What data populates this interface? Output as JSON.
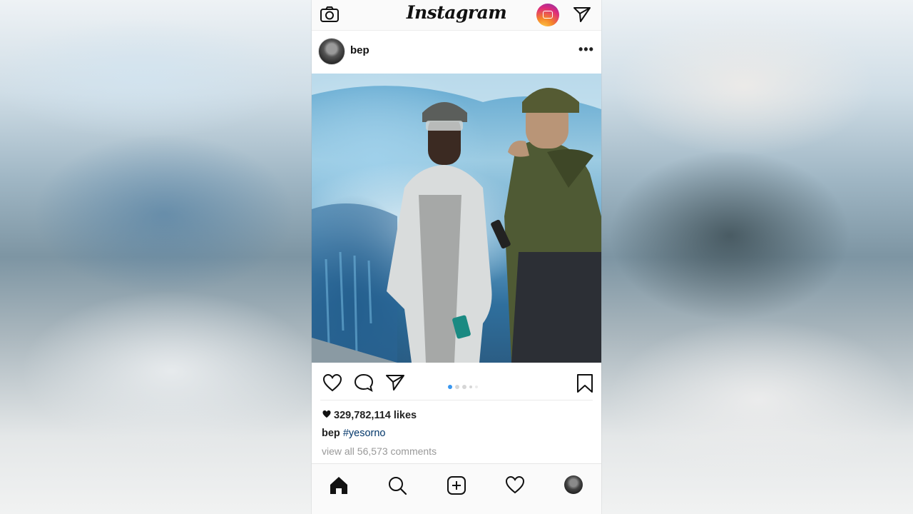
{
  "app": {
    "logo_text": "Instagram",
    "icons": {
      "camera": "camera-icon",
      "igtv": "igtv-icon",
      "direct": "direct-send-icon"
    }
  },
  "post": {
    "username": "bep",
    "more_label": "•••",
    "likes_text": "329,782,114 likes",
    "caption_user": "bep",
    "caption_hashtag": "#yesorno",
    "view_comments": "view all 56,573 comments",
    "carousel": {
      "total": 5,
      "active_index": 0
    }
  },
  "nav": {
    "items": [
      "home-icon",
      "search-icon",
      "new-post-icon",
      "activity-heart-icon",
      "profile-avatar"
    ]
  },
  "colors": {
    "accent_blue": "#3897f0",
    "hashtag": "#003569",
    "muted": "#999999"
  }
}
